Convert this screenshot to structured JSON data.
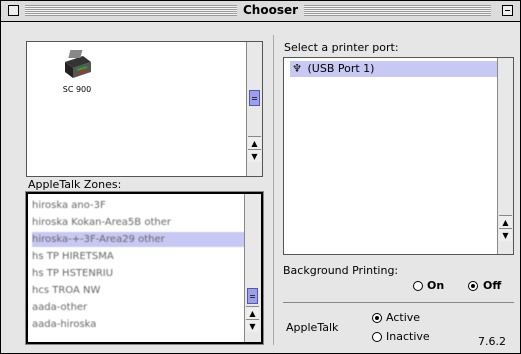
{
  "window": {
    "title": "Chooser"
  },
  "printer_icons": [
    {
      "label": "SC 900"
    }
  ],
  "zones": {
    "label": "AppleTalk Zones:",
    "items": [
      "hiroska ano-3F",
      "hiroska Kokan-Area5B other",
      "hiroska-+-3F-Area29 other",
      "hs TP HIRETSMA",
      "hs TP HSTENRIU",
      "hcs TROA NW",
      "aada-other",
      "aada-hiroska"
    ],
    "selected_index": 2
  },
  "port": {
    "label": "Select a printer port:",
    "items": [
      {
        "icon": "usb-icon",
        "label": "(USB Port 1)"
      }
    ]
  },
  "background_printing": {
    "label": "Background Printing:",
    "on_label": "On",
    "off_label": "Off",
    "selected": "Off"
  },
  "appletalk": {
    "label": "AppleTalk",
    "active_label": "Active",
    "inactive_label": "Inactive",
    "selected": "Active"
  },
  "version": "7.6.2",
  "colors": {
    "selection": "#c8c8f4",
    "scroll_thumb": "#9aa0ee"
  }
}
